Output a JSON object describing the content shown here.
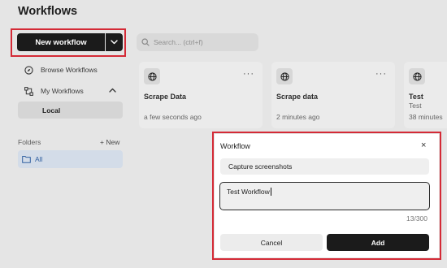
{
  "header": {
    "title": "Workflows"
  },
  "toolbar": {
    "new_workflow_label": "New workflow",
    "search_placeholder": "Search... (ctrl+f)"
  },
  "sidebar": {
    "items": [
      {
        "label": "Browse Workflows",
        "icon": "compass-icon"
      },
      {
        "label": "My Workflows",
        "icon": "workflow-icon",
        "expanded": true
      }
    ],
    "sub_items": [
      {
        "label": "Local",
        "selected": true
      }
    ],
    "folders_label": "Folders",
    "new_folder_label": "+ New",
    "folders": [
      {
        "label": "All",
        "icon": "folder-icon",
        "selected": true
      }
    ]
  },
  "cards": [
    {
      "title": "Scrape Data",
      "subtitle": "",
      "time": "a few seconds ago",
      "icon": "globe-icon"
    },
    {
      "title": "Scrape data",
      "subtitle": "",
      "time": "2 minutes ago",
      "icon": "globe-icon"
    },
    {
      "title": "Test",
      "subtitle": "Test",
      "time": "38 minutes",
      "icon": "globe-icon"
    }
  ],
  "card_menu_glyph": "···",
  "modal": {
    "title": "Workflow",
    "close_glyph": "×",
    "name_value": "Capture screenshots",
    "description_value": "Test Workflow",
    "counter": "13/300",
    "cancel_label": "Cancel",
    "add_label": "Add"
  },
  "colors": {
    "primary_button": "#1b1b1b",
    "highlight_outline": "#d42a36",
    "selected_folder_bg": "#d3dce8",
    "folder_accent": "#3160a0"
  }
}
